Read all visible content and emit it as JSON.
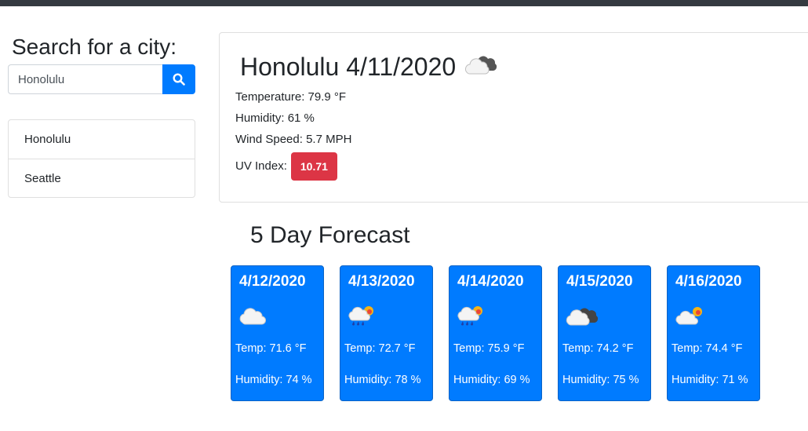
{
  "search": {
    "title": "Search for a city:",
    "input_value": "Honolulu",
    "button_icon": "search-icon"
  },
  "history": [
    {
      "label": "Honolulu"
    },
    {
      "label": "Seattle"
    }
  ],
  "current": {
    "city": "Honolulu",
    "date": "4/11/2020",
    "icon": "broken-clouds",
    "temperature_label": "Temperature:",
    "temperature": "79.9 °F",
    "humidity_label": "Humidity:",
    "humidity": "61 %",
    "wind_label": "Wind Speed:",
    "wind": "5.7 MPH",
    "uv_label": "UV Index:",
    "uv": "10.71",
    "uv_color": "#dc3545"
  },
  "forecast": {
    "title": "5 Day Forecast",
    "card_color": "#007bff",
    "days": [
      {
        "date": "4/12/2020",
        "icon": "cloud",
        "temp": "Temp: 71.6 °F",
        "humidity": "Humidity: 74 %"
      },
      {
        "date": "4/13/2020",
        "icon": "rain-sun",
        "temp": "Temp: 72.7 °F",
        "humidity": "Humidity: 78 %"
      },
      {
        "date": "4/14/2020",
        "icon": "rain-sun",
        "temp": "Temp: 75.9 °F",
        "humidity": "Humidity: 69 %"
      },
      {
        "date": "4/15/2020",
        "icon": "broken-clouds",
        "temp": "Temp: 74.2 °F",
        "humidity": "Humidity: 75 %"
      },
      {
        "date": "4/16/2020",
        "icon": "cloud-sun",
        "temp": "Temp: 74.4 °F",
        "humidity": "Humidity: 71 %"
      }
    ]
  }
}
